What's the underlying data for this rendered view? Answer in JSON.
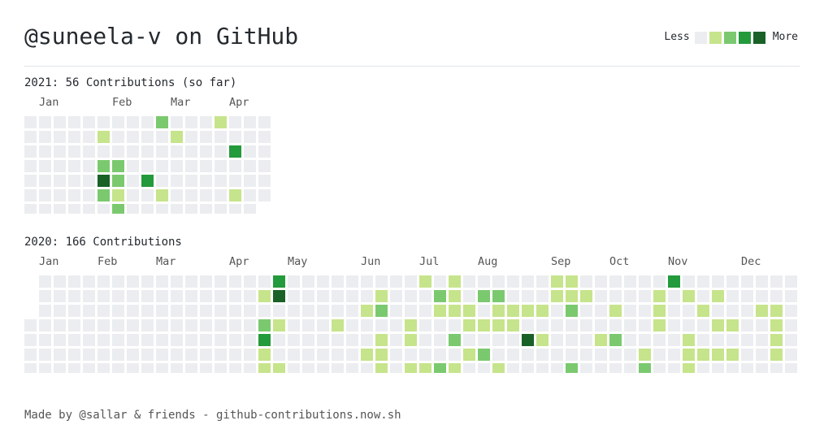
{
  "title": "@suneela-v on GitHub",
  "legend": {
    "less": "Less",
    "more": "More",
    "colors": [
      "#ebedf0",
      "#c6e48b",
      "#7bc96f",
      "#239a3b",
      "#196127"
    ]
  },
  "years": [
    {
      "title": "2021: 56 Contributions (so far)",
      "months": [
        {
          "label": "Jan",
          "week": 1
        },
        {
          "label": "Feb",
          "week": 6
        },
        {
          "label": "Mar",
          "week": 10
        },
        {
          "label": "Apr",
          "week": 14
        }
      ],
      "grid": [
        [
          0,
          0,
          0,
          0,
          0,
          0,
          0,
          0,
          0,
          2,
          0,
          0,
          0,
          1,
          0,
          0,
          0
        ],
        [
          0,
          0,
          0,
          0,
          0,
          1,
          0,
          0,
          0,
          0,
          1,
          0,
          0,
          0,
          0,
          0,
          0
        ],
        [
          0,
          0,
          0,
          0,
          0,
          0,
          0,
          0,
          0,
          0,
          0,
          0,
          0,
          0,
          3,
          0,
          0
        ],
        [
          0,
          0,
          0,
          0,
          0,
          2,
          2,
          0,
          0,
          0,
          0,
          0,
          0,
          0,
          0,
          0,
          0
        ],
        [
          0,
          0,
          0,
          0,
          0,
          4,
          2,
          0,
          3,
          0,
          0,
          0,
          0,
          0,
          0,
          0,
          0
        ],
        [
          0,
          0,
          0,
          0,
          0,
          2,
          1,
          0,
          0,
          1,
          0,
          0,
          0,
          0,
          1,
          0,
          0
        ],
        [
          0,
          0,
          0,
          0,
          0,
          0,
          2,
          0,
          0,
          0,
          0,
          0,
          0,
          0,
          0,
          0,
          null
        ]
      ]
    },
    {
      "title": "2020: 166 Contributions",
      "months": [
        {
          "label": "Jan",
          "week": 1
        },
        {
          "label": "Feb",
          "week": 5
        },
        {
          "label": "Mar",
          "week": 9
        },
        {
          "label": "Apr",
          "week": 14
        },
        {
          "label": "May",
          "week": 18
        },
        {
          "label": "Jun",
          "week": 23
        },
        {
          "label": "Jul",
          "week": 27
        },
        {
          "label": "Aug",
          "week": 31
        },
        {
          "label": "Sep",
          "week": 36
        },
        {
          "label": "Oct",
          "week": 40
        },
        {
          "label": "Nov",
          "week": 44
        },
        {
          "label": "Dec",
          "week": 49
        }
      ],
      "grid": [
        [
          null,
          0,
          0,
          0,
          0,
          0,
          0,
          0,
          0,
          0,
          0,
          0,
          0,
          0,
          0,
          0,
          0,
          3,
          0,
          0,
          0,
          0,
          0,
          0,
          0,
          0,
          0,
          1,
          0,
          1,
          0,
          0,
          0,
          0,
          0,
          0,
          1,
          1,
          0,
          0,
          0,
          0,
          0,
          0,
          3,
          0,
          0,
          0,
          0,
          0,
          0,
          0,
          0
        ],
        [
          null,
          0,
          0,
          0,
          0,
          0,
          0,
          0,
          0,
          0,
          0,
          0,
          0,
          0,
          0,
          0,
          1,
          4,
          0,
          0,
          0,
          0,
          0,
          0,
          1,
          0,
          0,
          0,
          2,
          1,
          0,
          2,
          2,
          0,
          0,
          0,
          1,
          1,
          1,
          0,
          0,
          0,
          0,
          1,
          0,
          1,
          0,
          1,
          0,
          0,
          0,
          0,
          0
        ],
        [
          null,
          0,
          0,
          0,
          0,
          0,
          0,
          0,
          0,
          0,
          0,
          0,
          0,
          0,
          0,
          0,
          0,
          0,
          0,
          0,
          0,
          0,
          0,
          1,
          2,
          0,
          0,
          0,
          1,
          1,
          1,
          0,
          1,
          1,
          1,
          1,
          0,
          2,
          0,
          0,
          1,
          0,
          0,
          1,
          0,
          0,
          1,
          0,
          0,
          0,
          1,
          1,
          0
        ],
        [
          0,
          0,
          0,
          0,
          0,
          0,
          0,
          0,
          0,
          0,
          0,
          0,
          0,
          0,
          0,
          0,
          2,
          1,
          0,
          0,
          0,
          1,
          0,
          0,
          0,
          0,
          1,
          0,
          0,
          0,
          1,
          1,
          1,
          1,
          0,
          0,
          0,
          0,
          0,
          0,
          0,
          0,
          0,
          1,
          0,
          0,
          0,
          1,
          1,
          0,
          0,
          1,
          0
        ],
        [
          0,
          0,
          0,
          0,
          0,
          0,
          0,
          0,
          0,
          0,
          0,
          0,
          0,
          0,
          0,
          0,
          3,
          0,
          0,
          0,
          0,
          0,
          0,
          0,
          1,
          0,
          1,
          0,
          0,
          2,
          0,
          0,
          0,
          0,
          4,
          1,
          0,
          0,
          0,
          1,
          2,
          0,
          0,
          0,
          0,
          1,
          0,
          0,
          0,
          0,
          0,
          1,
          0,
          1
        ],
        [
          0,
          0,
          0,
          0,
          0,
          0,
          0,
          0,
          0,
          0,
          0,
          0,
          0,
          0,
          0,
          0,
          1,
          0,
          0,
          0,
          0,
          0,
          0,
          1,
          1,
          0,
          0,
          0,
          0,
          0,
          1,
          2,
          0,
          0,
          0,
          0,
          0,
          0,
          0,
          0,
          0,
          0,
          1,
          0,
          0,
          1,
          1,
          1,
          1,
          0,
          0,
          1,
          0,
          null
        ],
        [
          0,
          0,
          0,
          0,
          0,
          0,
          0,
          0,
          0,
          0,
          0,
          0,
          0,
          0,
          0,
          0,
          1,
          1,
          0,
          0,
          0,
          0,
          0,
          0,
          1,
          0,
          1,
          1,
          2,
          1,
          0,
          0,
          1,
          0,
          0,
          0,
          0,
          2,
          0,
          0,
          0,
          0,
          2,
          0,
          0,
          1,
          0,
          0,
          0,
          0,
          0,
          0,
          0,
          null
        ]
      ]
    }
  ],
  "footer": "Made by @sallar & friends - github-contributions.now.sh"
}
